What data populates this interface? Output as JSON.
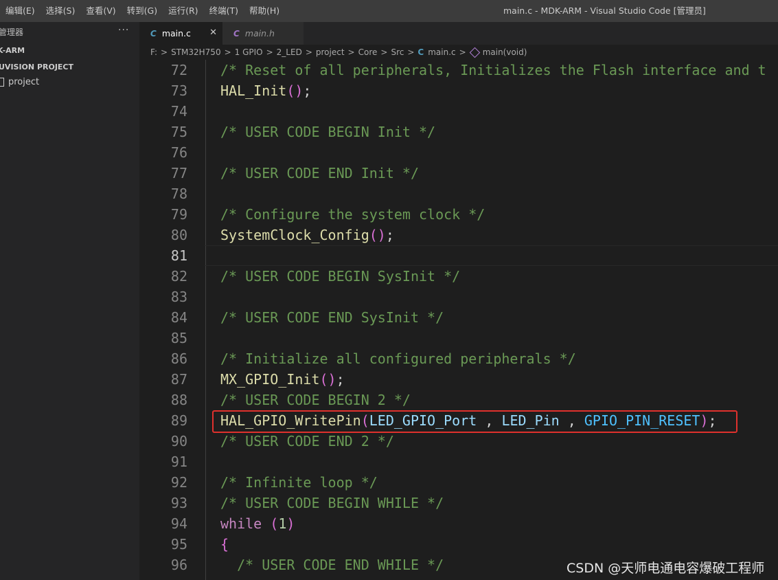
{
  "titlebar": {
    "menu": [
      "编辑(E)",
      "选择(S)",
      "查看(V)",
      "转到(G)",
      "运行(R)",
      "终端(T)",
      "帮助(H)"
    ],
    "window_title": "main.c - MDK-ARM - Visual Studio Code [管理员]"
  },
  "sidebar": {
    "header": "管理器",
    "more": "···",
    "root": "K-ARM",
    "section": "UVISION PROJECT",
    "file": "project"
  },
  "tabs": [
    {
      "icon": "C",
      "label": "main.c",
      "close": "✕"
    },
    {
      "icon": "C",
      "label": "main.h"
    }
  ],
  "breadcrumb": {
    "parts": [
      "F:",
      "STM32H750",
      "1 GPIO",
      "2_LED",
      "project",
      "Core",
      "Src"
    ],
    "file_icon": "C",
    "file": "main.c",
    "symbol": "main(void)",
    "separator": ">"
  },
  "editor": {
    "lines": [
      {
        "n": "72",
        "text": "/* Reset of all peripherals, Initializes the Flash interface and t"
      },
      {
        "n": "73",
        "text": "HAL_Init();"
      },
      {
        "n": "74",
        "text": ""
      },
      {
        "n": "75",
        "text": "/* USER CODE BEGIN Init */"
      },
      {
        "n": "76",
        "text": ""
      },
      {
        "n": "77",
        "text": "/* USER CODE END Init */"
      },
      {
        "n": "78",
        "text": ""
      },
      {
        "n": "79",
        "text": "/* Configure the system clock */"
      },
      {
        "n": "80",
        "text": "SystemClock_Config();"
      },
      {
        "n": "81",
        "text": ""
      },
      {
        "n": "82",
        "text": "/* USER CODE BEGIN SysInit */"
      },
      {
        "n": "83",
        "text": ""
      },
      {
        "n": "84",
        "text": "/* USER CODE END SysInit */"
      },
      {
        "n": "85",
        "text": ""
      },
      {
        "n": "86",
        "text": "/* Initialize all configured peripherals */"
      },
      {
        "n": "87",
        "text": "MX_GPIO_Init();"
      },
      {
        "n": "88",
        "text": "/* USER CODE BEGIN 2 */"
      },
      {
        "n": "89",
        "text": "HAL_GPIO_WritePin(LED_GPIO_Port , LED_Pin , GPIO_PIN_RESET);"
      },
      {
        "n": "90",
        "text": "/* USER CODE END 2 */"
      },
      {
        "n": "91",
        "text": ""
      },
      {
        "n": "92",
        "text": "/* Infinite loop */"
      },
      {
        "n": "93",
        "text": "/* USER CODE BEGIN WHILE */"
      },
      {
        "n": "94",
        "text": "while (1)"
      },
      {
        "n": "95",
        "text": "{"
      },
      {
        "n": "96",
        "text": "  /* USER CODE END WHILE */"
      }
    ],
    "current_line": "81"
  },
  "watermark": "CSDN @天师电通电容爆破工程师",
  "colors": {
    "highlight_box": "#e0312d",
    "comment": "#6a9955",
    "function": "#dcdcaa",
    "variable": "#9cdcfe",
    "constant": "#4fc1ff",
    "keyword": "#c586c0"
  }
}
